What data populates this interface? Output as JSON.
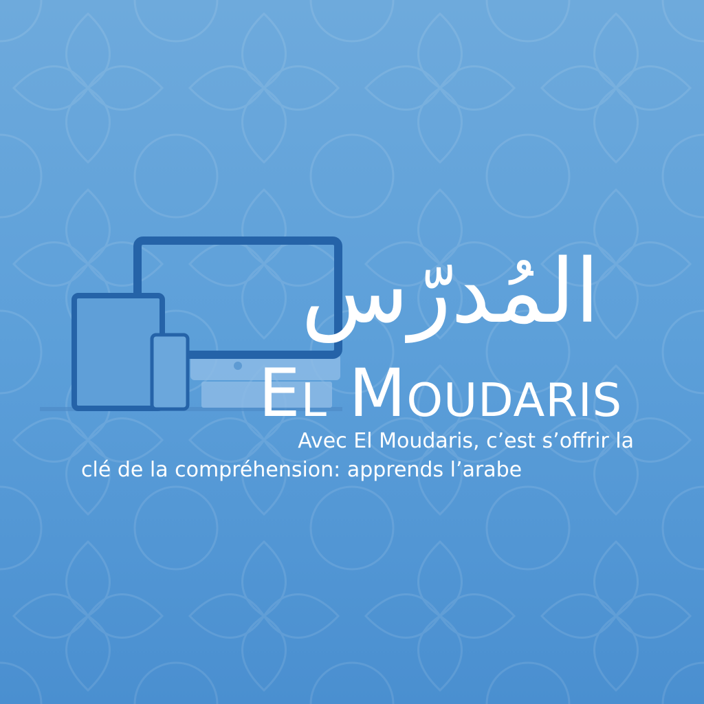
{
  "title_arabic": "المُدرّس",
  "brand_name": "El Moudaris",
  "tagline": {
    "line1": "Avec El Moudaris, c’est s’offrir la",
    "line2": "clé de la compréhension: apprends l’arabe"
  },
  "colors": {
    "background_top": "#6eaadc",
    "background_bottom": "#4a8fd0",
    "device": "#2563a8",
    "text": "#ffffff"
  },
  "icons": [
    "desktop-monitor-icon",
    "tablet-icon",
    "smartphone-icon"
  ]
}
